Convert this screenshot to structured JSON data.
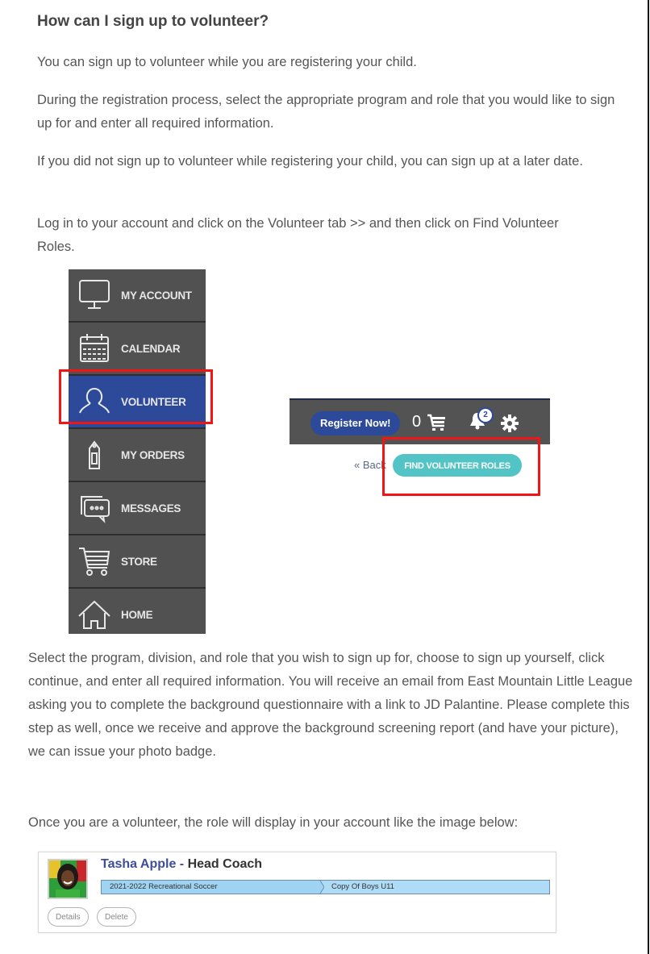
{
  "heading": "How can I sign up to volunteer?",
  "paragraphs": [
    "You can sign up to volunteer while you are registering your child.",
    "During the registration process, select the appropriate program and role that you would like to sign up for and enter all required information.",
    "If you did not sign up to volunteer while registering your child, you can sign up at a later date.",
    "Log in to your account and click on the  Volunteer tab >> and then click on Find Volunteer Roles.",
    "Select the program, division, and role that you wish to sign up for, choose to sign up yourself, click continue, and enter all required information. You will receive an email from East Mountain Little League asking you to complete the background questionnaire with a link to JD Palantine. Please complete this step as well, once we receive and approve the background screening report (and have your picture), we can issue your photo badge.",
    "Once you are a volunteer, the role will display in your account like the image below:"
  ],
  "sidebar": {
    "items": [
      {
        "label": "MY ACCOUNT",
        "icon": "monitor-icon",
        "active": false
      },
      {
        "label": "CALENDAR",
        "icon": "calendar-icon",
        "active": false
      },
      {
        "label": "VOLUNTEER",
        "icon": "person-icon",
        "active": true
      },
      {
        "label": "MY ORDERS",
        "icon": "tag-icon",
        "active": false
      },
      {
        "label": "MESSAGES",
        "icon": "chat-icon",
        "active": false
      },
      {
        "label": "STORE",
        "icon": "cart-icon",
        "active": false
      },
      {
        "label": "HOME",
        "icon": "home-icon",
        "active": false
      }
    ],
    "active_color": "#2d4a9a",
    "bg_color": "#515151"
  },
  "topbar": {
    "register_label": "Register Now!",
    "cart_count": "0",
    "notification_count": "2",
    "back_label": "« Back",
    "find_roles_label": "FIND VOLUNTEER ROLES"
  },
  "highlight_color": "#f21515",
  "role_card": {
    "name": "Tasha Apple",
    "separator": " - ",
    "role": "Head Coach",
    "program": "2021-2022 Recreational Soccer",
    "division": "Copy Of Boys U11",
    "details_label": "Details",
    "delete_label": "Delete"
  }
}
